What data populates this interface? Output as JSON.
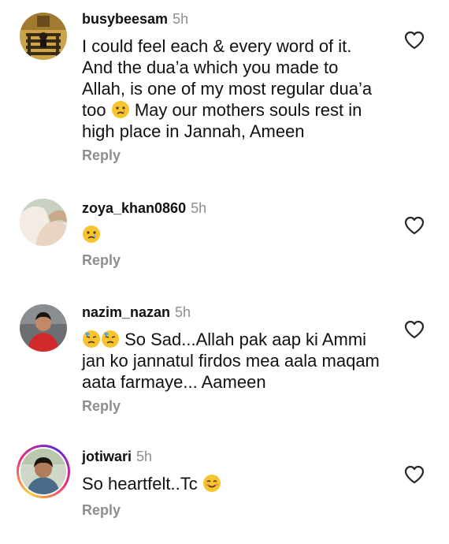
{
  "comments": [
    {
      "username": "busybeesam",
      "time": "5h",
      "text_before": "I could feel each & every word of it. And the dua’a which you made to Allah, is one of my most regular dua’a too ",
      "text_after": " May our mothers souls rest in high place in Jannah, Ameen",
      "emojis": [
        "crying-face"
      ],
      "reply": "Reply"
    },
    {
      "username": "zoya_khan0860",
      "time": "5h",
      "emojis": [
        "crying-face"
      ],
      "reply": "Reply"
    },
    {
      "username": "nazim_nazan",
      "time": "5h",
      "text_after": " So Sad...Allah pak aap ki Ammi jan ko jannatul firdos mea aala maqam aata farmaye... Aameen",
      "emojis": [
        "downcast-sweat-face",
        "downcast-sweat-face"
      ],
      "reply": "Reply"
    },
    {
      "username": "jotiwari",
      "time": "5h",
      "text_before": "So heartfelt..Tc ",
      "emojis": [
        "smiling-face"
      ],
      "reply": "Reply"
    }
  ],
  "icons": {
    "like": "heart-outline-icon",
    "emoji_color": "#f7c32e"
  }
}
